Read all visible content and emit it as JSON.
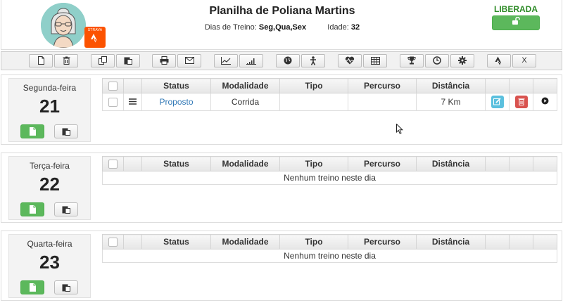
{
  "header": {
    "title": "Planilha de Poliana Martins",
    "dias_label": "Dias de Treino:",
    "dias_value": "Seg,Qua,Sex",
    "idade_label": "Idade:",
    "idade_value": "32",
    "status": "LIBERADA",
    "badge_text": "STRAVA"
  },
  "toolbar": {
    "close_label": "X"
  },
  "table_headers": [
    "",
    "",
    "Status",
    "Modalidade",
    "Tipo",
    "Percurso",
    "Distância",
    "",
    "",
    ""
  ],
  "days": [
    {
      "name": "Segunda-feira",
      "number": "21",
      "rows": [
        {
          "status": "Proposto",
          "modalidade": "Corrida",
          "tipo": "",
          "percurso": "",
          "distancia": "7 Km"
        }
      ],
      "empty_text": ""
    },
    {
      "name": "Terça-feira",
      "number": "22",
      "rows": [],
      "empty_text": "Nenhum treino neste dia"
    },
    {
      "name": "Quarta-feira",
      "number": "23",
      "rows": [],
      "empty_text": "Nenhum treino neste dia"
    }
  ],
  "colors": {
    "success": "#5cb85c",
    "status_ok": "#2e8b27",
    "info": "#5bc0de",
    "danger": "#d9534f",
    "link": "#337ab7",
    "strava": "#fc5200"
  }
}
